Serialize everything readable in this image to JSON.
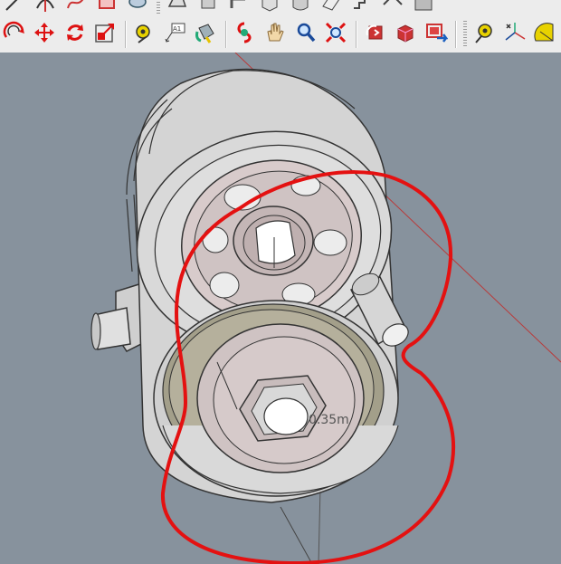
{
  "app": {
    "name": "SketchUp"
  },
  "toolbar_top": [
    {
      "name": "line-tool",
      "icon": "pencil-icon"
    },
    {
      "name": "arc-tool",
      "icon": "arc-icon"
    },
    {
      "name": "freehand-tool",
      "icon": "freehand-icon"
    },
    {
      "name": "rectangle-tool",
      "icon": "rectangle-icon"
    },
    {
      "name": "circle-tool",
      "icon": "circle-icon"
    },
    {
      "name": "polygon-tool",
      "icon": "polygon-icon"
    },
    {
      "name": "push-pull-tool",
      "icon": "push-pull-icon"
    },
    {
      "name": "follow-me-tool",
      "icon": "follow-me-icon"
    },
    {
      "name": "box-tool",
      "icon": "box-icon"
    },
    {
      "name": "cylinder-tool",
      "icon": "cylinder-icon"
    },
    {
      "name": "section-tool",
      "icon": "section-icon"
    },
    {
      "name": "stairs-tool",
      "icon": "stairs-icon"
    },
    {
      "name": "roof-tool",
      "icon": "roof-icon"
    },
    {
      "name": "warehouse-tool",
      "icon": "warehouse-icon"
    }
  ],
  "toolbar_main": [
    {
      "name": "offset-tool",
      "icon": "offset-icon"
    },
    {
      "name": "move-tool",
      "icon": "move-icon"
    },
    {
      "name": "rotate-tool",
      "icon": "rotate-icon"
    },
    {
      "name": "scale-tool",
      "icon": "scale-icon"
    },
    {
      "name": "tape-measure-tool",
      "icon": "tape-measure-icon"
    },
    {
      "name": "text-tool",
      "icon": "text-icon",
      "label": "A1"
    },
    {
      "name": "paint-bucket-tool",
      "icon": "paint-bucket-icon"
    },
    {
      "name": "orbit-tool",
      "icon": "orbit-icon"
    },
    {
      "name": "pan-tool",
      "icon": "pan-hand-icon"
    },
    {
      "name": "zoom-tool",
      "icon": "zoom-icon"
    },
    {
      "name": "zoom-extents-tool",
      "icon": "zoom-extents-icon"
    },
    {
      "name": "previous-view",
      "icon": "previous-view-icon"
    },
    {
      "name": "next-view",
      "icon": "next-view-icon"
    },
    {
      "name": "get-models",
      "icon": "get-models-icon"
    },
    {
      "name": "tape-measure-tool-2",
      "icon": "tape-measure-icon"
    },
    {
      "name": "axes-tool",
      "icon": "axes-icon"
    },
    {
      "name": "protractor-tool",
      "icon": "protractor-icon"
    }
  ],
  "viewport": {
    "dimension_label": "0.35m",
    "colors": {
      "background": "#87929d",
      "body": "#d9d9d9",
      "cap": "#cfc3c3",
      "gasket": "#a39f8a",
      "red_outline": "#e41111",
      "axis_red": "#c03030"
    }
  }
}
